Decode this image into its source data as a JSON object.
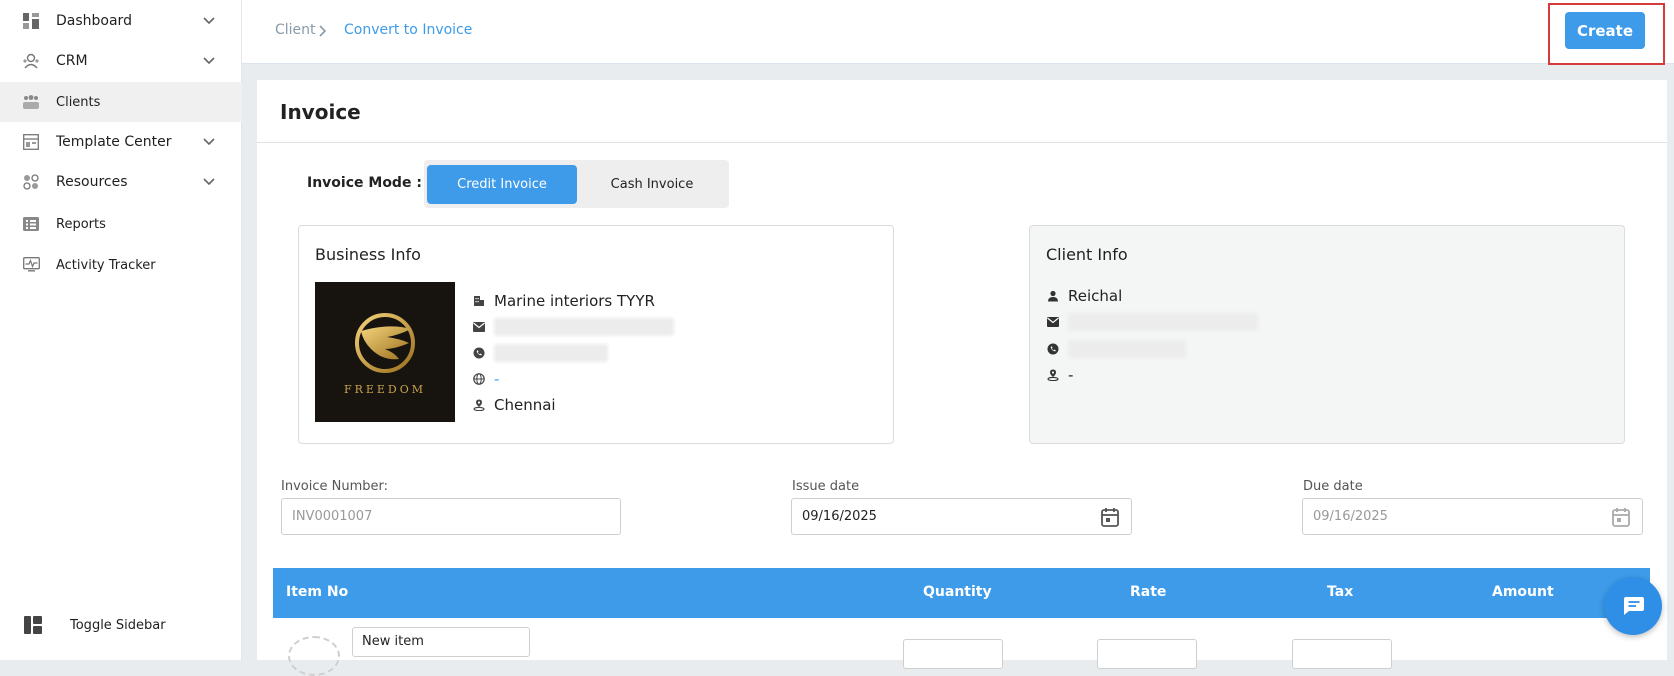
{
  "sidebar": {
    "items": [
      {
        "label": "Dashboard",
        "icon": "dashboard-icon",
        "has_chevron": true
      },
      {
        "label": "CRM",
        "icon": "crm-icon",
        "has_chevron": true
      },
      {
        "label": "Clients",
        "icon": "clients-icon",
        "has_chevron": false,
        "active": true
      },
      {
        "label": "Template Center",
        "icon": "template-icon",
        "has_chevron": true
      },
      {
        "label": "Resources",
        "icon": "resources-icon",
        "has_chevron": true
      },
      {
        "label": "Reports",
        "icon": "reports-icon",
        "has_chevron": false
      },
      {
        "label": "Activity Tracker",
        "icon": "activity-icon",
        "has_chevron": false
      }
    ],
    "toggle_label": "Toggle Sidebar"
  },
  "header": {
    "breadcrumb": [
      "Client",
      "Convert to Invoice"
    ],
    "create_label": "Create"
  },
  "invoice": {
    "title": "Invoice",
    "mode_label": "Invoice Mode :",
    "modes": [
      "Credit Invoice",
      "Cash Invoice"
    ],
    "selected_mode": "Credit Invoice"
  },
  "business": {
    "title": "Business Info",
    "logo_text": "FREEDOM",
    "name": "Marine interiors TYYR",
    "website": "-",
    "location": "Chennai"
  },
  "client": {
    "title": "Client Info",
    "name": "Reichal",
    "location": "-"
  },
  "fields": {
    "invoice_number_label": "Invoice Number:",
    "invoice_number_placeholder": "INV0001007",
    "issue_date_label": "Issue date",
    "issue_date_value": "09/16/2025",
    "due_date_label": "Due date",
    "due_date_value": "09/16/2025"
  },
  "table": {
    "headers": [
      "Item No",
      "Quantity",
      "Rate",
      "Tax",
      "Amount"
    ],
    "first_row_item": "New item"
  },
  "colors": {
    "accent": "#3d9be9",
    "highlight_border": "#d63b3b"
  }
}
